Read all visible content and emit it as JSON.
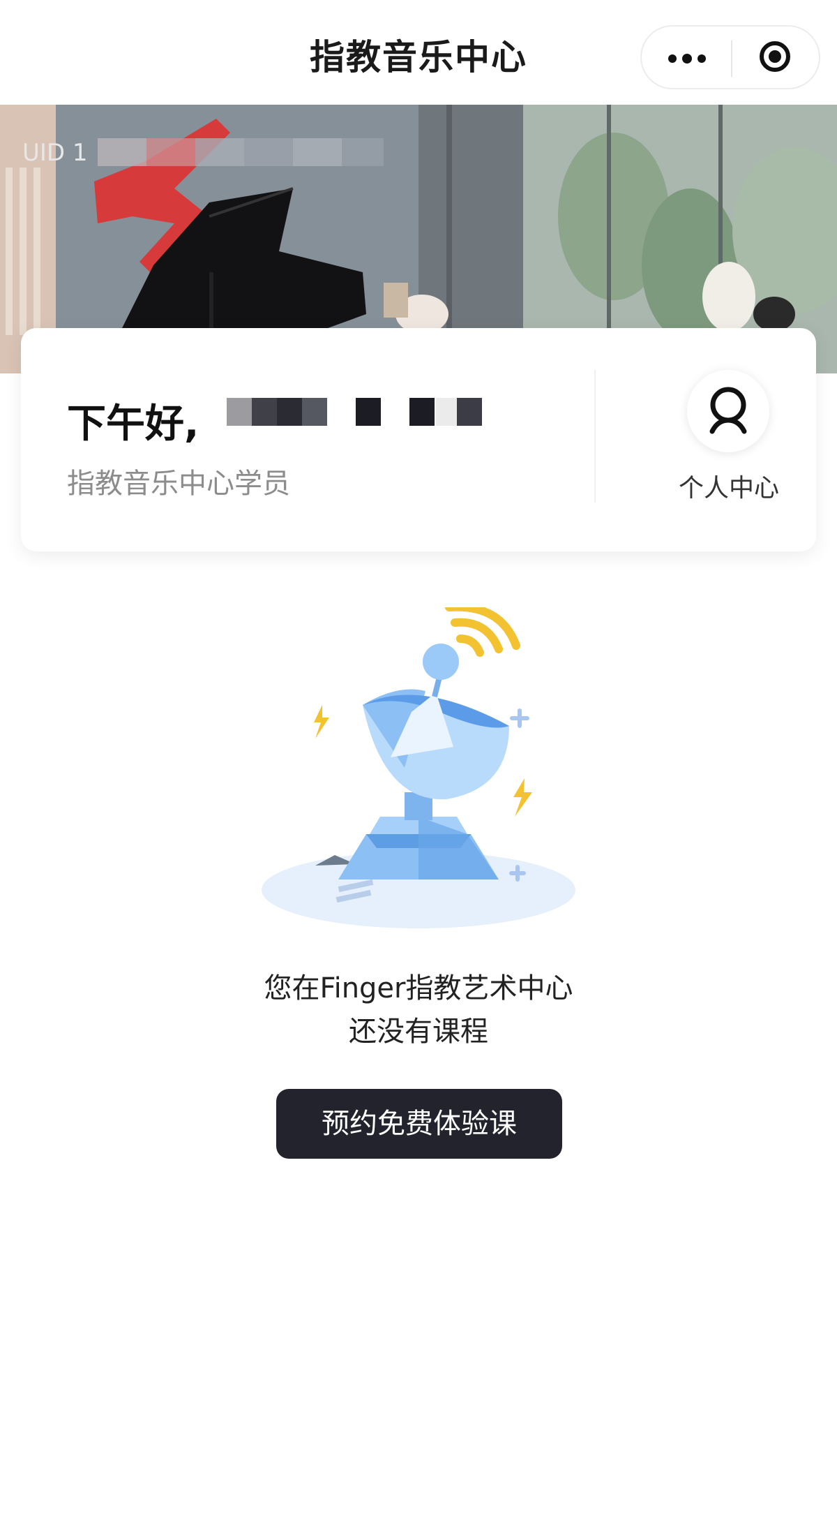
{
  "nav": {
    "title": "指教音乐中心"
  },
  "banner": {
    "uid_text": "UID 1"
  },
  "card": {
    "greeting": "下午好,",
    "subtitle": "指教音乐中心学员",
    "profile_label": "个人中心"
  },
  "empty_state": {
    "line1": "您在Finger指教艺术中心",
    "line2": "还没有课程",
    "button": "预约免费体验课"
  },
  "colors": {
    "cta_bg": "#23232d",
    "accent_yellow": "#f2c230",
    "illustration_blue": "#5b9be8"
  }
}
